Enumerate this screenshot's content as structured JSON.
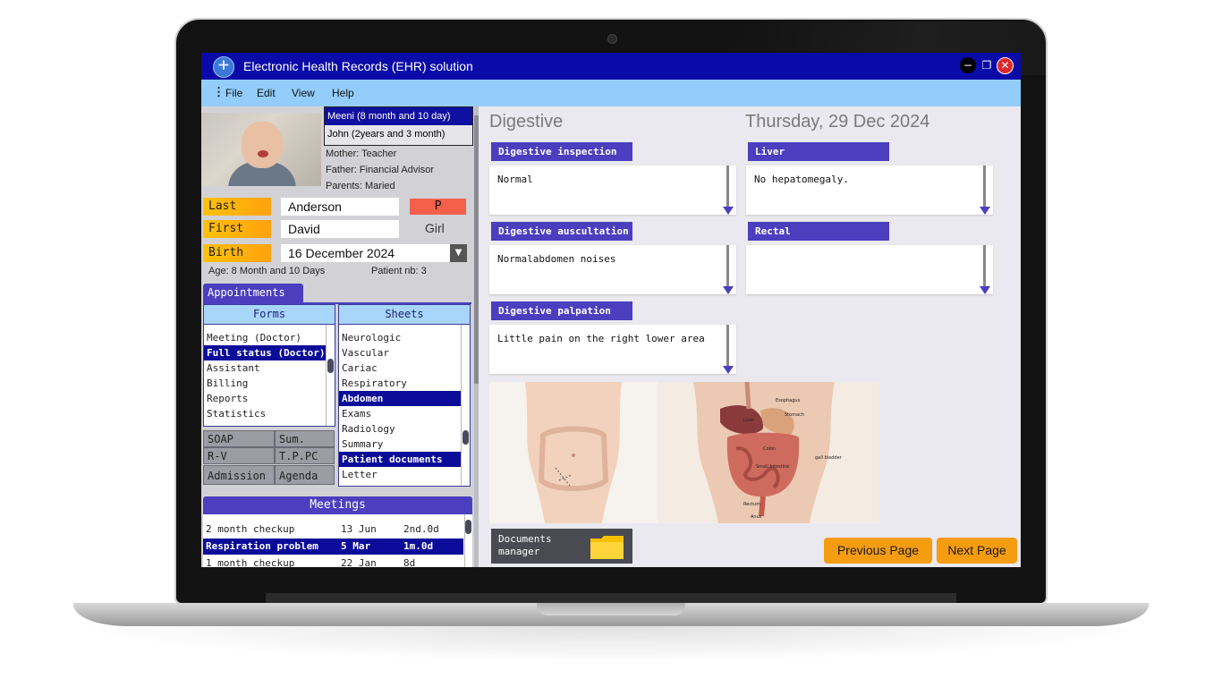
{
  "window": {
    "title": "Electronic Health Records (EHR) solution",
    "minimize": "−",
    "restore": "❐",
    "close": "✕"
  },
  "menu": {
    "dots": "⋮",
    "items": [
      "File",
      "Edit",
      "View",
      "Help"
    ]
  },
  "patient": {
    "children": [
      {
        "label": "Meeni (8 month and 10 day)",
        "selected": true
      },
      {
        "label": "John (2years and 3 month)",
        "selected": false
      }
    ],
    "mother": "Mother: Teacher",
    "father": "Father: Financial Advisor",
    "parents": "Parents: Maried",
    "last_label": "Last",
    "last_value": "Anderson",
    "badge": "P",
    "first_label": "First",
    "first_value": "David",
    "gender": "Girl",
    "birth_label": "Birth",
    "birth_value": "16 December 2024",
    "age": "Age: 8 Month and 10 Days",
    "patient_nb": "Patient nb: 3"
  },
  "appointments": {
    "tab": "Appointments",
    "forms": {
      "header": "Forms",
      "items": [
        "Meeting (Doctor)",
        "Full status (Doctor)",
        "Assistant",
        "Billing",
        "Reports",
        "Statistics"
      ],
      "selected_index": 1
    },
    "sheets": {
      "header": "Sheets",
      "items": [
        "Neurologic",
        "Vascular",
        "Cariac",
        "Respiratory",
        "Abdomen",
        "Exams",
        "Radiology",
        "Summary",
        "Patient documents",
        "Letter"
      ],
      "selected": [
        "Abdomen",
        "Patient documents"
      ]
    },
    "grid_buttons": [
      "SOAP",
      "Sum.",
      "R-V",
      "T.P.PC",
      "Admission",
      "Agenda"
    ]
  },
  "meetings": {
    "header": "Meetings",
    "rows": [
      {
        "name": "2 month checkup",
        "date": "13 Jun",
        "dur": "2nd.0d",
        "selected": false
      },
      {
        "name": "Respiration problem",
        "date": "5 Mar",
        "dur": "1m.0d",
        "selected": true
      },
      {
        "name": "1 month checkup",
        "date": "22 Jan",
        "dur": "8d",
        "selected": false
      }
    ]
  },
  "content": {
    "section": "Digestive",
    "date": "Thursday, 29 Dec 2024",
    "fields": {
      "inspection": {
        "label": "Digestive inspection",
        "value": "Normal"
      },
      "auscultation": {
        "label": "Digestive auscultation",
        "value": "Normalabdomen noises"
      },
      "palpation": {
        "label": "Digestive palpation",
        "value": "Little pain on the right lower area"
      },
      "liver": {
        "label": "Liver",
        "value": "No hepatomegaly."
      },
      "rectal": {
        "label": "Rectal",
        "value": ""
      }
    },
    "anatomy_labels": [
      "Esophagus",
      "Stomach",
      "Liver",
      "Colon",
      "gall bladder",
      "Small Intestine",
      "Rectum",
      "Anus"
    ],
    "documents_manager": [
      "Documents",
      "manager"
    ],
    "prev_page": "Previous Page",
    "next_page": "Next Page"
  },
  "colors": {
    "titlebar": "#0a0aa8",
    "menubar": "#92cdfc",
    "accent": "#4b3fbf",
    "label_orange": "#ffb00c",
    "button_orange": "#f59c10",
    "selected": "#0c0c9a"
  }
}
